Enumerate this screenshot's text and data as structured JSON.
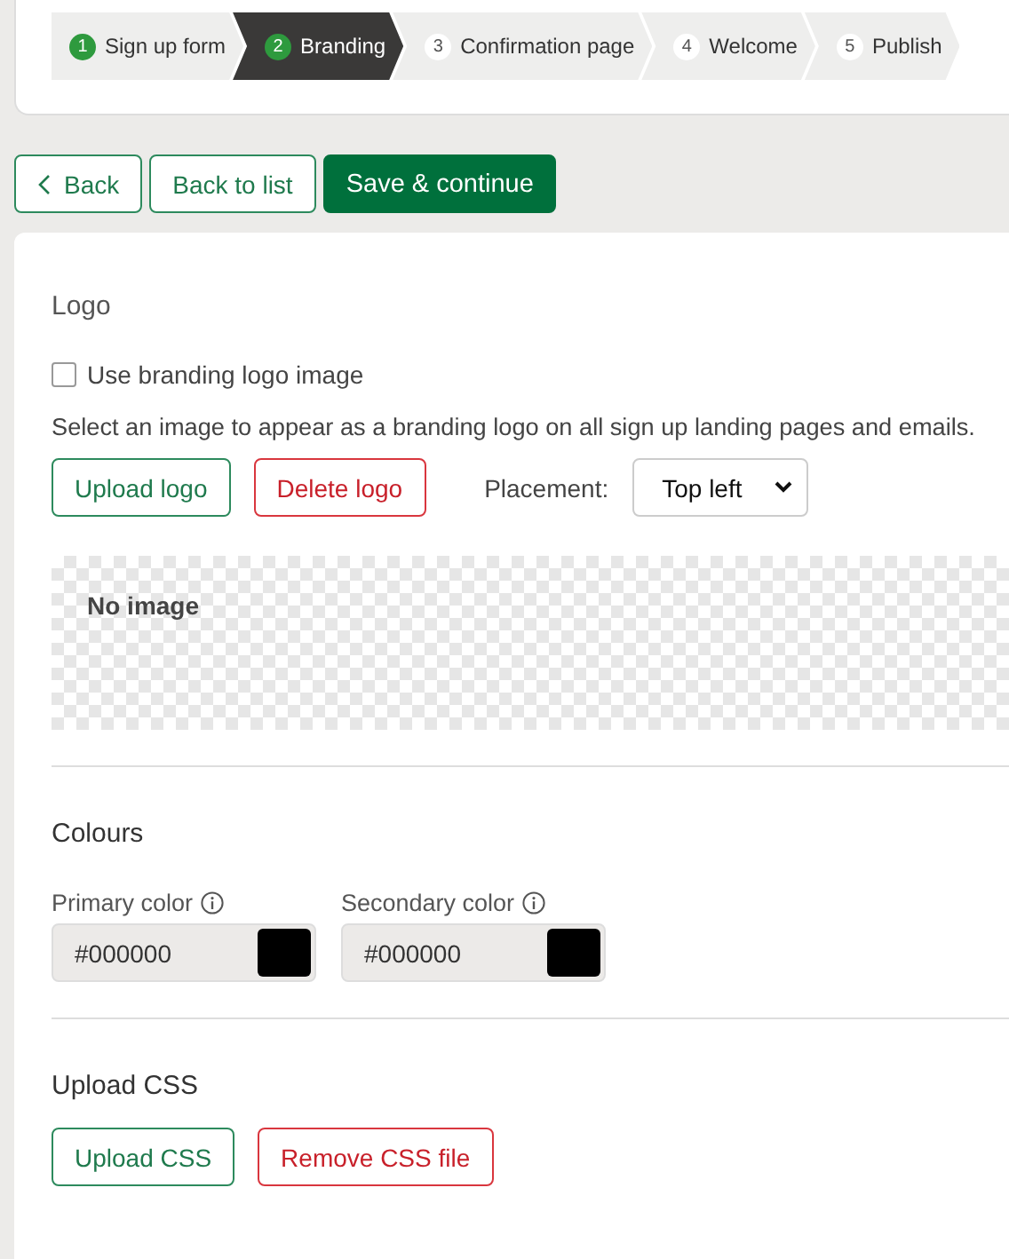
{
  "steps": [
    {
      "number": "1",
      "label": "Sign up form",
      "selected": false,
      "completed": true
    },
    {
      "number": "2",
      "label": "Branding",
      "selected": true,
      "completed": true
    },
    {
      "number": "3",
      "label": "Confirmation page",
      "selected": false,
      "completed": false
    },
    {
      "number": "4",
      "label": "Welcome",
      "selected": false,
      "completed": false
    },
    {
      "number": "5",
      "label": "Publish",
      "selected": false,
      "completed": false
    }
  ],
  "actions": [
    {
      "label": "Back",
      "kind": "back"
    },
    {
      "label": "Back to list",
      "kind": "outline"
    },
    {
      "label": "Save & continue",
      "kind": "primary"
    }
  ],
  "logo": {
    "title": "Logo",
    "checkbox": {
      "label": "Use branding logo image",
      "checked": false
    },
    "description": "Select an image to appear as a branding logo on all sign up landing pages and emails.",
    "buttons": [
      {
        "label": "Upload logo",
        "kind": "outline"
      },
      {
        "label": "Delete logo",
        "kind": "danger"
      }
    ],
    "placement": {
      "label": "Placement:",
      "value": "Top left"
    },
    "preview": {
      "text": "No image"
    }
  },
  "colours": {
    "title": "Colours",
    "fields": [
      {
        "label": "Primary color",
        "value": "#000000",
        "color": "#000000"
      },
      {
        "label": "Secondary color",
        "value": "#000000",
        "color": "#000000"
      }
    ]
  },
  "css": {
    "title": "Upload CSS",
    "buttons": [
      {
        "label": "Upload CSS",
        "kind": "outline"
      },
      {
        "label": "Remove CSS file",
        "kind": "danger"
      }
    ]
  }
}
